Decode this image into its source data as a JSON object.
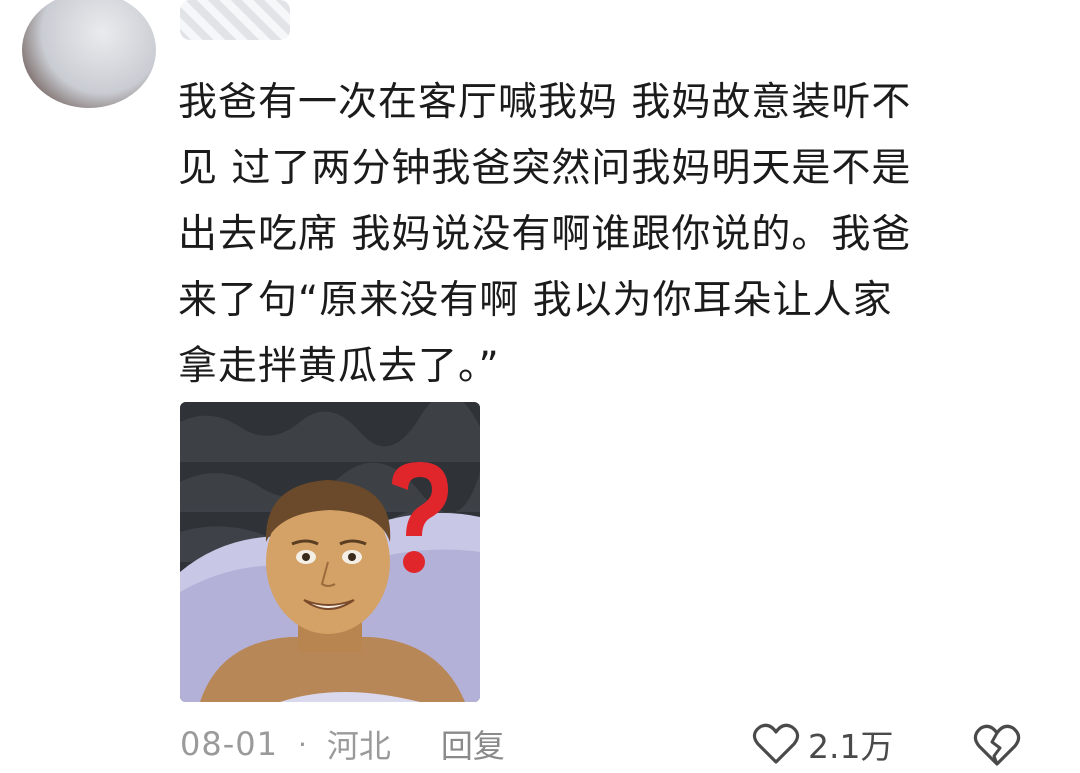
{
  "comment": {
    "text": "我爸有一次在客厅喊我妈 我妈故意装听不见 过了两分钟我爸突然问我妈明天是不是出去吃席 我妈说没有啊谁跟你说的。我爸来了句“原来没有啊 我以为你耳朵让人家拿走拌黄瓜去了。”",
    "lines": [
      "我爸有一次在客厅喊我妈 我妈故意装听不",
      "见 过了两分钟我爸突然问我妈明天是不是",
      "出去吃席 我妈说没有啊谁跟你说的。我爸",
      "来了句“原来没有啊 我以为你耳朵让人家",
      "拿走拌黄瓜去了。”"
    ],
    "date": "08-01",
    "separator": "·",
    "location": "河北",
    "reply_label": "回复",
    "like_count": "2.1万",
    "icons": {
      "like": "heart-outline-icon",
      "dislike": "broken-heart-icon"
    },
    "colors": {
      "text": "#1b1b1b",
      "meta": "#9a9a9a",
      "question_mark": "#e0262b"
    }
  }
}
